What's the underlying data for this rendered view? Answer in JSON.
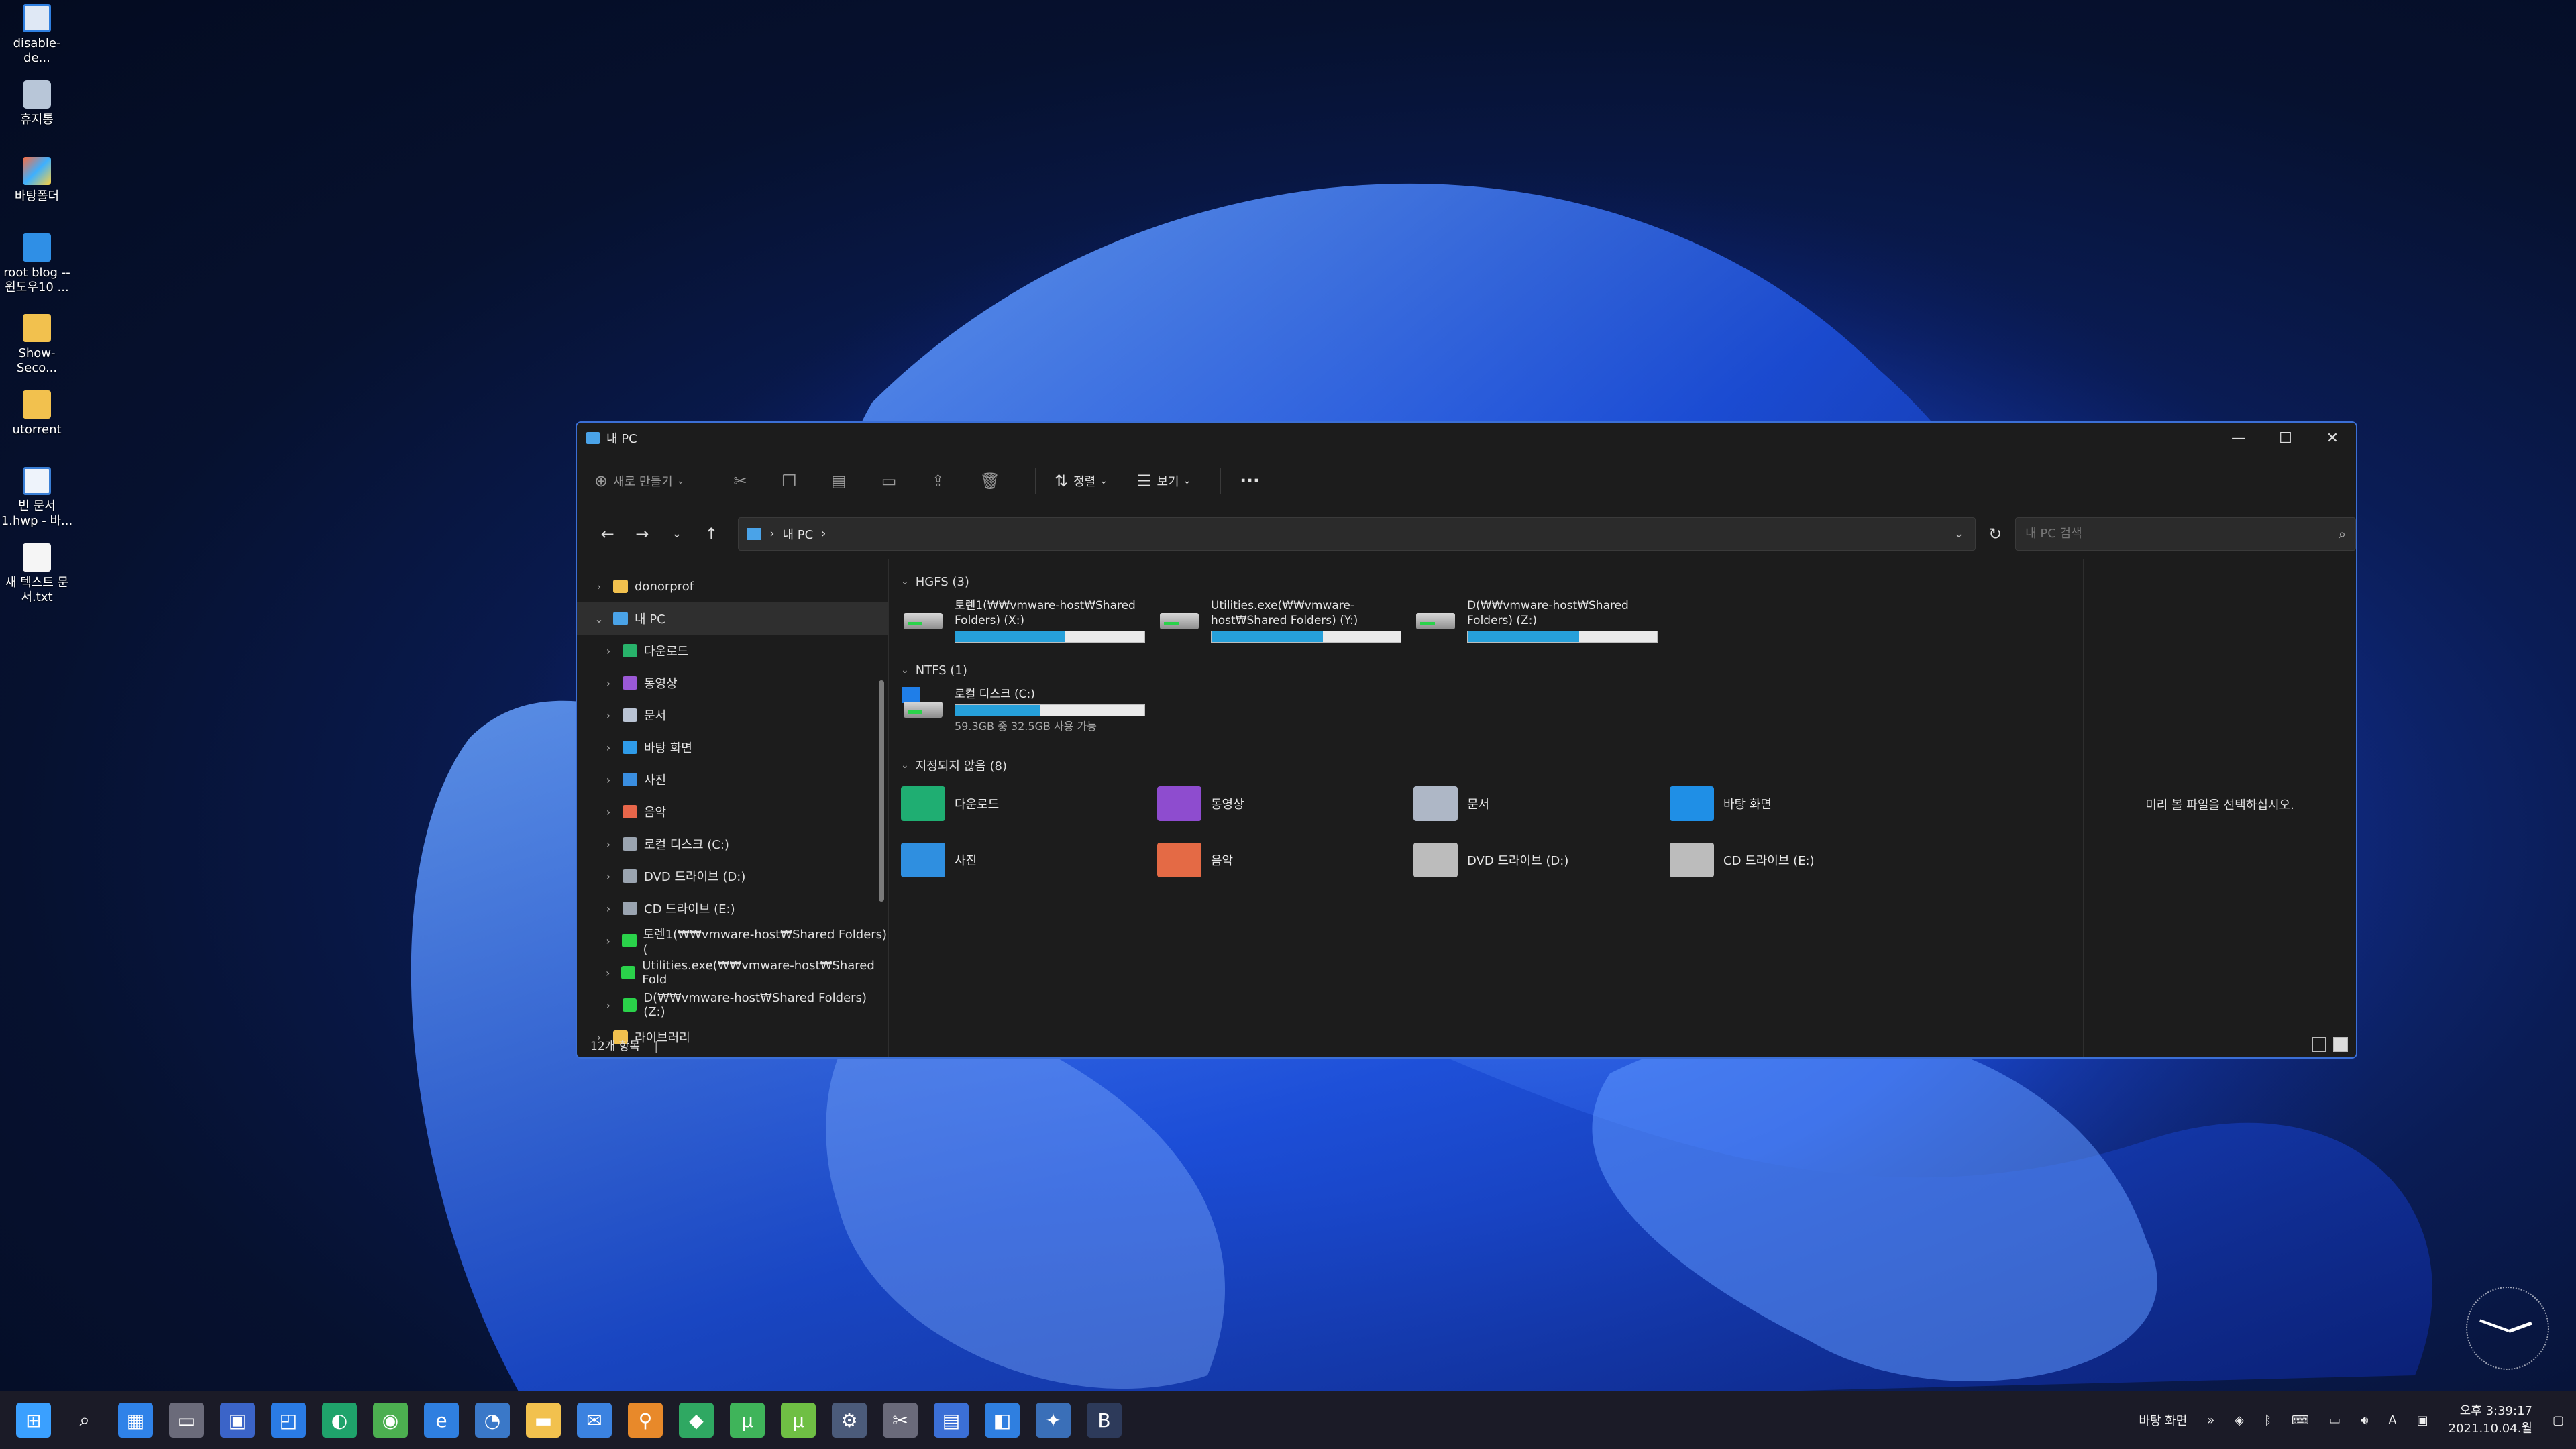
{
  "desktop": {
    "icons": [
      {
        "label": "disable-de...",
        "icon": "shortcut-icon"
      },
      {
        "label": "휴지통",
        "icon": "recycle-bin-icon"
      },
      {
        "label": "바탕폴더",
        "icon": "app-icon"
      },
      {
        "label": "root blog -- 윈도우10 ...",
        "icon": "document-icon"
      },
      {
        "label": "Show-Seco...",
        "icon": "folder-icon"
      },
      {
        "label": "utorrent",
        "icon": "folder-icon"
      },
      {
        "label": "빈 문서 1.hwp - 바...",
        "icon": "hwp-icon"
      },
      {
        "label": "새 텍스트 문서.txt",
        "icon": "text-file-icon"
      }
    ]
  },
  "window": {
    "title": "내 PC",
    "controls": {
      "minimize": "—",
      "maximize": "☐",
      "close": "✕"
    }
  },
  "toolbar": {
    "new_label": "새로 만들기",
    "sort_label": "정렬",
    "view_label": "보기",
    "more_label": "···"
  },
  "address": {
    "crumb": "내 PC",
    "sep": "›"
  },
  "search": {
    "placeholder": "내 PC 검색"
  },
  "nav_tree": [
    {
      "label": "donorprof",
      "icon_color": "#f2c14e",
      "level": 0,
      "expanded": false
    },
    {
      "label": "내 PC",
      "icon_color": "#4aa3e8",
      "level": 0,
      "expanded": true,
      "selected": true
    },
    {
      "label": "다운로드",
      "icon_color": "#28b36b",
      "level": 1
    },
    {
      "label": "동영상",
      "icon_color": "#9b59d6",
      "level": 1
    },
    {
      "label": "문서",
      "icon_color": "#b9c3d3",
      "level": 1
    },
    {
      "label": "바탕 화면",
      "icon_color": "#2f9be8",
      "level": 1
    },
    {
      "label": "사진",
      "icon_color": "#3a8ee0",
      "level": 1
    },
    {
      "label": "음악",
      "icon_color": "#e8664a",
      "level": 1
    },
    {
      "label": "로컬 디스크 (C:)",
      "icon_color": "#9aa4b0",
      "level": 1
    },
    {
      "label": "DVD 드라이브 (D:)",
      "icon_color": "#9aa4b0",
      "level": 1
    },
    {
      "label": "CD 드라이브 (E:)",
      "icon_color": "#9aa4b0",
      "level": 1
    },
    {
      "label": "토렌1(₩₩vmware-host₩Shared Folders) (",
      "icon_color": "#2ad24a",
      "level": 1
    },
    {
      "label": "Utilities.exe(₩₩vmware-host₩Shared Fold",
      "icon_color": "#2ad24a",
      "level": 1
    },
    {
      "label": "D(₩₩vmware-host₩Shared Folders) (Z:)",
      "icon_color": "#2ad24a",
      "level": 1
    },
    {
      "label": "라이브러리",
      "icon_color": "#f2c14e",
      "level": 0
    }
  ],
  "status": {
    "count": "12개 항목"
  },
  "groups": {
    "hgfs": {
      "label": "HGFS (3)",
      "drives": [
        {
          "name": "토렌1(₩₩vmware-host₩Shared Folders) (X:)",
          "used_fraction": 0.58
        },
        {
          "name": "Utilities.exe(₩₩vmware-host₩Shared Folders) (Y:)",
          "used_fraction": 0.59
        },
        {
          "name": "D(₩₩vmware-host₩Shared Folders) (Z:)",
          "used_fraction": 0.59
        }
      ]
    },
    "ntfs": {
      "label": "NTFS (1)",
      "drives": [
        {
          "name": "로컬 디스크 (C:)",
          "used_fraction": 0.45,
          "space": "59.3GB 중 32.5GB 사용 가능"
        }
      ]
    },
    "unassigned": {
      "label": "지정되지 않음 (8)",
      "items": [
        {
          "name": "다운로드",
          "icon": "downloads-folder-icon",
          "color": "#1fae72"
        },
        {
          "name": "동영상",
          "icon": "videos-folder-icon",
          "color": "#8e4ccf"
        },
        {
          "name": "문서",
          "icon": "documents-folder-icon",
          "color": "#aeb7c6"
        },
        {
          "name": "바탕 화면",
          "icon": "desktop-folder-icon",
          "color": "#1f8fe6"
        },
        {
          "name": "사진",
          "icon": "pictures-folder-icon",
          "color": "#2f8fe0"
        },
        {
          "name": "음악",
          "icon": "music-folder-icon",
          "color": "#e46a45"
        },
        {
          "name": "DVD 드라이브 (D:)",
          "icon": "dvd-drive-icon",
          "color": "#bcbcbc"
        },
        {
          "name": "CD 드라이브 (E:)",
          "icon": "cd-drive-icon",
          "color": "#bcbcbc"
        }
      ]
    }
  },
  "preview": {
    "text": "미리 볼 파일을 선택하십시오."
  },
  "taskbar": {
    "apps": [
      {
        "icon": "start-icon",
        "color": "#3aa0ff",
        "glyph": "⊞"
      },
      {
        "icon": "search-icon",
        "color": "transparent",
        "glyph": "⌕"
      },
      {
        "icon": "widgets-icon",
        "color": "#2f82e8",
        "glyph": "▦"
      },
      {
        "icon": "taskview-icon",
        "color": "#6b6b7a",
        "glyph": "▭"
      },
      {
        "icon": "save-icon",
        "color": "#3b64c8",
        "glyph": "▣"
      },
      {
        "icon": "store-icon",
        "color": "#2a7be4",
        "glyph": "◰"
      },
      {
        "icon": "edge-icon",
        "color": "#1fa36b",
        "glyph": "◐"
      },
      {
        "icon": "chrome-icon",
        "color": "#4caf50",
        "glyph": "◉"
      },
      {
        "icon": "ie-icon",
        "color": "#2f7fe0",
        "glyph": "e"
      },
      {
        "icon": "ccleaner-icon",
        "color": "#3a78c8",
        "glyph": "◔"
      },
      {
        "icon": "file-explorer-icon",
        "color": "#f2c14e",
        "glyph": "▬"
      },
      {
        "icon": "mail-icon",
        "color": "#3b82e0",
        "glyph": "✉"
      },
      {
        "icon": "magnifier-icon",
        "color": "#e8892a",
        "glyph": "⚲"
      },
      {
        "icon": "pin-icon",
        "color": "#2fa862",
        "glyph": "◆"
      },
      {
        "icon": "utorrent-icon",
        "color": "#3fb45a",
        "glyph": "µ"
      },
      {
        "icon": "torrent-icon",
        "color": "#6fbf44",
        "glyph": "µ"
      },
      {
        "icon": "tool-icon",
        "color": "#4b5b7a",
        "glyph": "⚙"
      },
      {
        "icon": "tools-icon",
        "color": "#6a6a7a",
        "glyph": "✂"
      },
      {
        "icon": "remote-icon",
        "color": "#3b6fd6",
        "glyph": "▤"
      },
      {
        "icon": "vscode-icon",
        "color": "#2f7fe0",
        "glyph": "◧"
      },
      {
        "icon": "settings-icon",
        "color": "#3a6fb8",
        "glyph": "✦"
      },
      {
        "icon": "bold-icon",
        "color": "#2d3a5a",
        "glyph": "B"
      }
    ],
    "tray": {
      "desktop_label": "바탕 화면",
      "ime": "A",
      "time": "오후 3:39:17",
      "date": "2021.10.04.월"
    }
  }
}
